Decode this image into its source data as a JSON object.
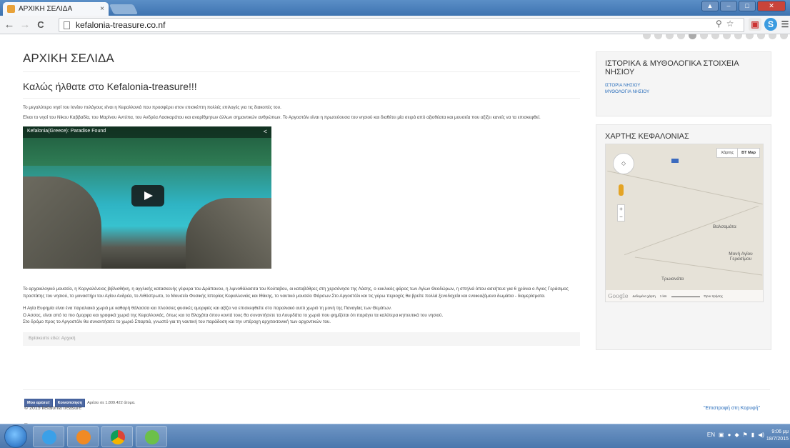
{
  "browser": {
    "tab_title": "ΑΡΧΙΚΗ ΣΕΛΙΔΑ",
    "tab_close": "×",
    "url": "kefalonia-treasure.co.nf",
    "back": "←",
    "forward": "→",
    "reload": "C"
  },
  "main": {
    "page_title": "ΑΡΧΙΚΗ ΣΕΛΙΔΑ",
    "welcome": "Καλώς ήλθατε στο Kefalonia-treasure!!!",
    "para1": "Το μεγαλύτερο νησί του Ιονίου πελάγους είναι η Κεφαλλονιά που προσφέρει στον επισκέπτη πολλές επιλογές για τις διακοπές του.",
    "para2": "Είναι το νησί του Νίκου Καββαδία, του Μαρίνου Αντύπα, του Ανδρέα Λασκαράτου και αναρίθμητων άλλων σημαντικών ανθρώπων. Το Αργοστόλι είναι η πρωτεύουσα του νησιού και διαθέτει μία σειρά από αξιοθέατα και μουσεία που αξίζει κανείς να τα επισκεφθεί.",
    "video_title": "Kefalonia(Greece): Paradise Found",
    "para3": "Το αρχαιολογικό μουσείο, η Κοργιαλένειος βιβλιοθήκη, η αγγλικής κατασκευής γέφυρα του Δράπανου, η λιμνοθάλασσα του Κούταβου, οι καταβόθρες στη χερσόνησο της Λάσης, ο κυκλικός φάρος των Αγίων Θεοδώρων, η σπηλιά όπου ασκήτευε για 6 χρόνια ο Αγιος Γεράσιμος προστάτης του νησιού, το μοναστήρι του Αγίου Ανδρέα, το Λιθόστρωτο, το Μουσείο Φυσικής Ιστορίας Κεφαλλονιάς και Ιθάκης, το ναυτικό μουσείο Φάρσων.Στο Αργοστόλι και τις γύρω περιοχές θα βρείτε πολλά ξενοδοχεία και ενοικιαζόμενα δωμάτια - διαμερίσματα.",
    "para4": "Η Αγία Ευφημία είναι ένα παραλιακό χωριό με καθαρή θάλασσα και πλούσιες φυσικές ομορφιές και αξίζει να επισκεφθείτε στο παραλιακό αυτό χωριό τη μονή της Παναγίας των Θεμάτων.",
    "para5": "Ο Ασσος, είναι από τα πιο όμορφα και γραφικά χωριά της Κεφαλλονιάς, όπως και τα Βλαχάτα όπου κοντά τους θα συναντήσετε τα Λουρδάτα το χωριό που φημίζεται ότι παράγει τα καλύτερα κηπευτικά του νησιού.",
    "para6": "Στο δρόμο προς το Αργοστόλι θα συναντήσετε το χωριό Σπαρτιά, γνωστό για τη ναυτική του παράδοση και την υπέροχη αρχιτεκτονική των αρχοντικών του.",
    "breadcrumb": "Βρίσκεστε εδώ:  Αρχική"
  },
  "sidebar": {
    "box1_title": "ΙΣΤΟΡΙΚΑ & ΜΥΘΟΛΟΓΙΚΑ ΣΤΟΙΧΕΙΑ ΝΗΣΙΟΥ",
    "links": [
      "ΙΣΤΟΡΙΑ ΝΗΣΙΟΥ",
      "ΜΥΘΟΛΟΓΙΑ ΝΗΣΙΟΥ"
    ],
    "box2_title": "ΧΑΡΤΗΣ ΚΕΦΑΛΟΝΙΑΣ",
    "map": {
      "type_map": "Χάρτης",
      "type_sat": "BT Map",
      "label_valsamata": "Βαλσαμάτα",
      "label_moni": "Μονή Αγίου Γερασίμου",
      "label_troianata": "Τρωιανάτα",
      "google": "Google",
      "attr_data": "Δεδομένα χάρτη",
      "scale": "1 km",
      "terms": "Όροι Χρήσης",
      "zoom_in": "+",
      "zoom_out": "−"
    }
  },
  "footer": {
    "fb_like": "Μου αρέσει!",
    "fb_share": "Κοινοποίηση",
    "fb_count": "Αρέσει σε 1.809.422 άτομα.",
    "copyright": "© 2015 kefalonia treasure",
    "back_to_top": "\"Επιστροφή στη Κορυφή\"",
    "dash": "–"
  },
  "taskbar": {
    "lang": "EN",
    "time": "9:06 μμ",
    "date": "18/7/2015"
  }
}
